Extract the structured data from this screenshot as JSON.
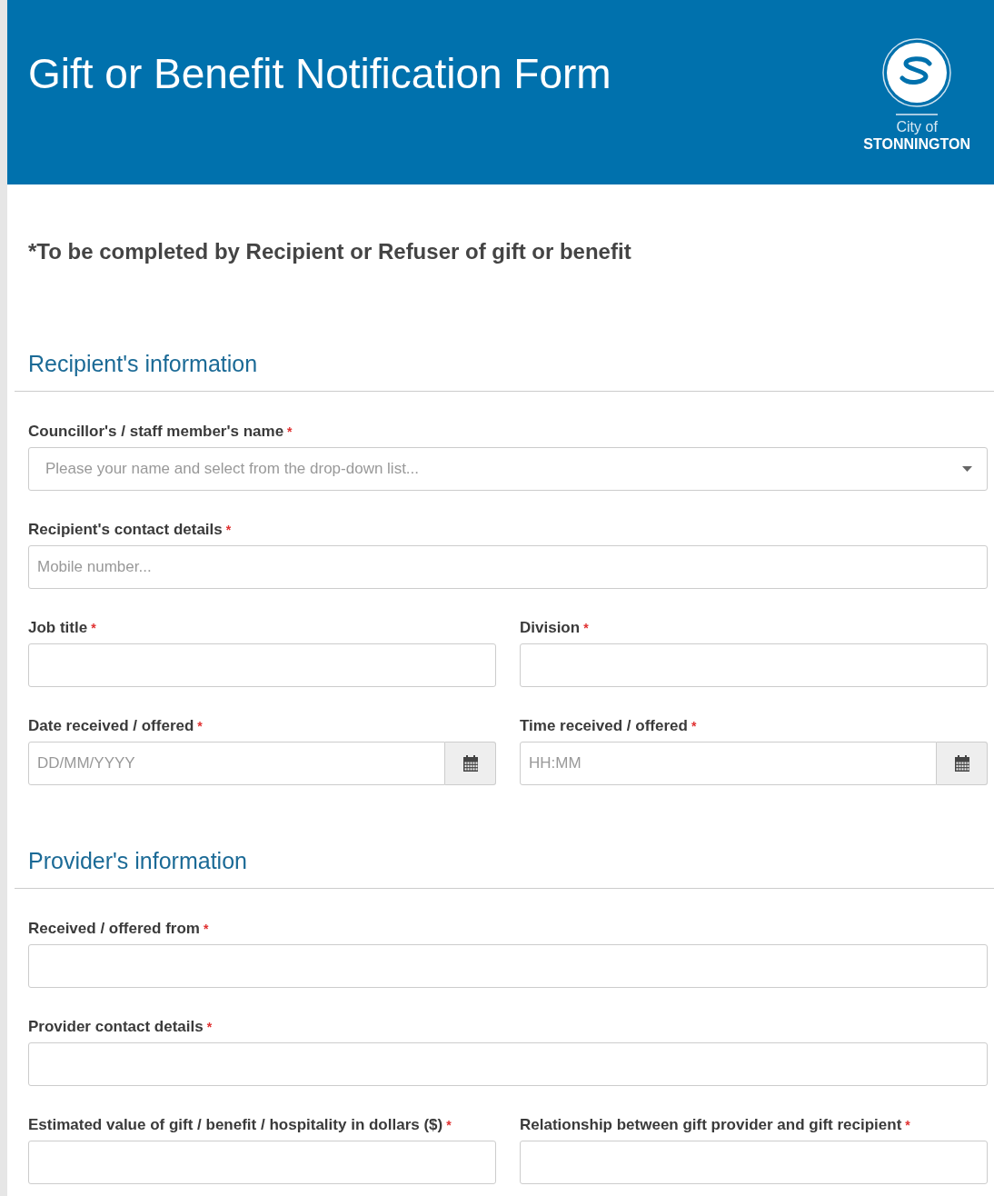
{
  "header": {
    "title": "Gift or Benefit Notification Form",
    "logo": {
      "line_1": "City of",
      "line_2": "STONNINGTON"
    }
  },
  "intro": "*To be completed by Recipient or Refuser of gift or benefit",
  "sections": [
    {
      "title": "Recipient's information",
      "rows": [
        [
          {
            "kind": "dropdown",
            "label": "Councillor's / staff member's name",
            "mark": "*",
            "placeholder": "Please your name and select from the drop-down list..."
          }
        ],
        [
          {
            "kind": "text",
            "label": "Recipient's contact details",
            "mark": "*",
            "placeholder": "Mobile number..."
          }
        ],
        [
          {
            "kind": "text",
            "label": "Job title",
            "mark": "*"
          },
          {
            "kind": "text",
            "label": "Division",
            "mark": "*"
          }
        ],
        [
          {
            "kind": "date",
            "label": "Date received / offered",
            "mark": "*",
            "placeholder": "DD/MM/YYYY"
          },
          {
            "kind": "date",
            "label": "Time received / offered",
            "mark": "*",
            "placeholder": "HH:MM"
          }
        ]
      ]
    },
    {
      "title": "Provider's information",
      "rows": [
        [
          {
            "kind": "text",
            "label": "Received / offered from",
            "mark": "*"
          }
        ],
        [
          {
            "kind": "text",
            "label": "Provider contact details",
            "mark": "*"
          }
        ],
        [
          {
            "kind": "text",
            "label": "Estimated value of gift / benefit / hospitality in dollars ($)",
            "mark": "*"
          },
          {
            "kind": "text",
            "label": "Relationship between gift provider and gift recipient",
            "mark": "*"
          }
        ]
      ]
    }
  ]
}
